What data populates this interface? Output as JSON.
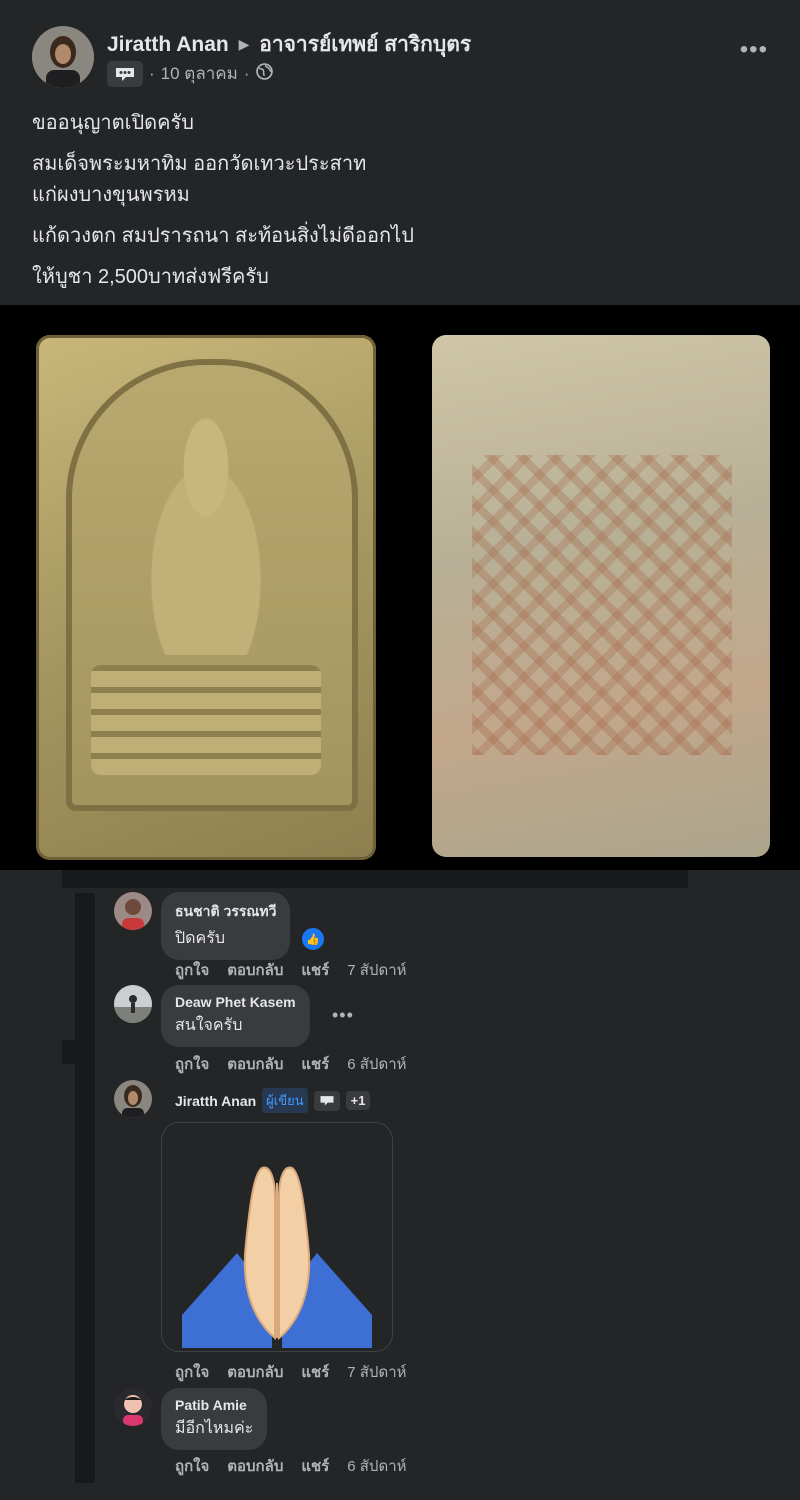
{
  "post": {
    "author": "Jiratth Anan",
    "target": "อาจารย์เทพย์ สาริกบุตร",
    "date": "10 ตุลาคม",
    "separator": "·",
    "lines": [
      "ขออนุญาตเปิดครับ",
      "สมเด็จพระมหาทิม ออกวัดเทวะประสาท",
      "แก่ผงบางขุนพรหม",
      "แก้ดวงตก  สมปรารถนา สะท้อนสิ่งไม่ดีออกไป",
      "ให้บูชา 2,500บาทส่งฟรีครับ"
    ],
    "more_label": "•••"
  },
  "comments": [
    {
      "name": "ธนชาติ วรรณทวี",
      "text": "ปิดครับ",
      "actions": [
        "ถูกใจ",
        "ตอบกลับ",
        "แชร์"
      ],
      "time": "7 สัปดาห์"
    },
    {
      "name": "Deaw Phet Kasem",
      "text": "สนใจครับ",
      "actions": [
        "ถูกใจ",
        "ตอบกลับ",
        "แชร์"
      ],
      "time": "6 สัปดาห์",
      "more_label": "•••"
    },
    {
      "name": "Jiratth Anan",
      "tag": "ผู้เขียน",
      "plus": "+1",
      "sticker": "praying-hands",
      "actions": [
        "ถูกใจ",
        "ตอบกลับ",
        "แชร์"
      ],
      "time": "7 สัปดาห์"
    },
    {
      "name": "Patib Amie",
      "text": "มีอีกไหมค่ะ",
      "actions": [
        "ถูกใจ",
        "ตอบกลับ",
        "แชร์"
      ],
      "time": "6 สัปดาห์"
    }
  ],
  "colors": {
    "background": "#242526",
    "bubble": "#3a3b3c",
    "secondary_text": "#b0b3b8",
    "accent": "#1877f2"
  }
}
